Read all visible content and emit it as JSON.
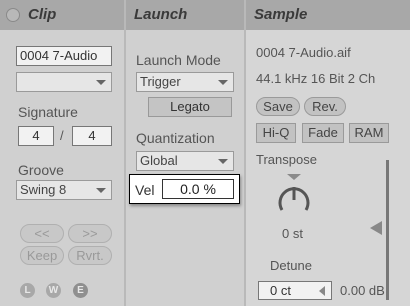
{
  "clip": {
    "title": "Clip",
    "name": "0004 7-Audio",
    "color_select": "",
    "signature_label": "Signature",
    "sig_num": "4",
    "sig_sep": "/",
    "sig_den": "4",
    "groove_label": "Groove",
    "groove_value": "Swing 8",
    "nudge_back": "<<",
    "nudge_fwd": ">>",
    "keep": "Keep",
    "revert": "Rvrt.",
    "icons": [
      "L",
      "W",
      "E"
    ]
  },
  "launch": {
    "title": "Launch",
    "mode_label": "Launch Mode",
    "mode_value": "Trigger",
    "legato": "Legato",
    "quant_label": "Quantization",
    "quant_value": "Global",
    "vel_label": "Vel",
    "vel_value": "0.0 %"
  },
  "sample": {
    "title": "Sample",
    "file": "0004 7-Audio.aif",
    "info": "44.1 kHz 16 Bit 2 Ch",
    "save": "Save",
    "rev": "Rev.",
    "hiq": "Hi-Q",
    "fade": "Fade",
    "ram": "RAM",
    "transpose_label": "Transpose",
    "transpose_value": "0 st",
    "detune_label": "Detune",
    "detune_value": "0 ct",
    "gain_value": "0.00 dB"
  },
  "colors": {
    "header": "#a8a8a8",
    "panel": "#d0d0d0",
    "highlight": "#ffffff"
  }
}
